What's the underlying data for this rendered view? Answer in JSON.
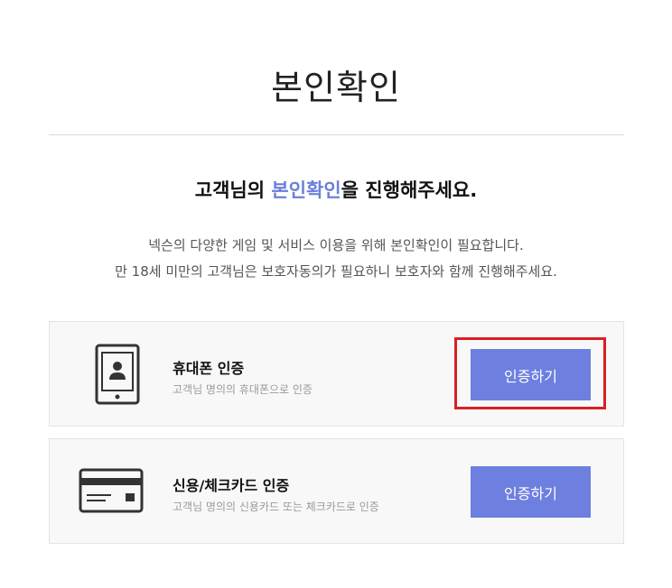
{
  "page": {
    "title": "본인확인"
  },
  "intro": {
    "headline_prefix": "고객님의 ",
    "headline_accent": "본인확인",
    "headline_suffix": "을 진행해주세요.",
    "desc_line1": "넥슨의 다양한 게임 및 서비스 이용을 위해 본인확인이 필요합니다.",
    "desc_line2": "만 18세 미만의 고객님은 보호자동의가 필요하니 보호자와 함께 진행해주세요."
  },
  "methods": [
    {
      "icon": "mobile-phone-icon",
      "title": "휴대폰 인증",
      "subtitle": "고객님 명의의 휴대폰으로 인증",
      "button": "인증하기"
    },
    {
      "icon": "credit-card-icon",
      "title": "신용/체크카드 인증",
      "subtitle": "고객님 명의의 신용카드 또는 체크카드로 인증",
      "button": "인증하기"
    }
  ],
  "colors": {
    "accent": "#6d7fd9",
    "button": "#6d7fdf",
    "highlight": "#d91f26",
    "card_bg": "#f8f8f8"
  }
}
